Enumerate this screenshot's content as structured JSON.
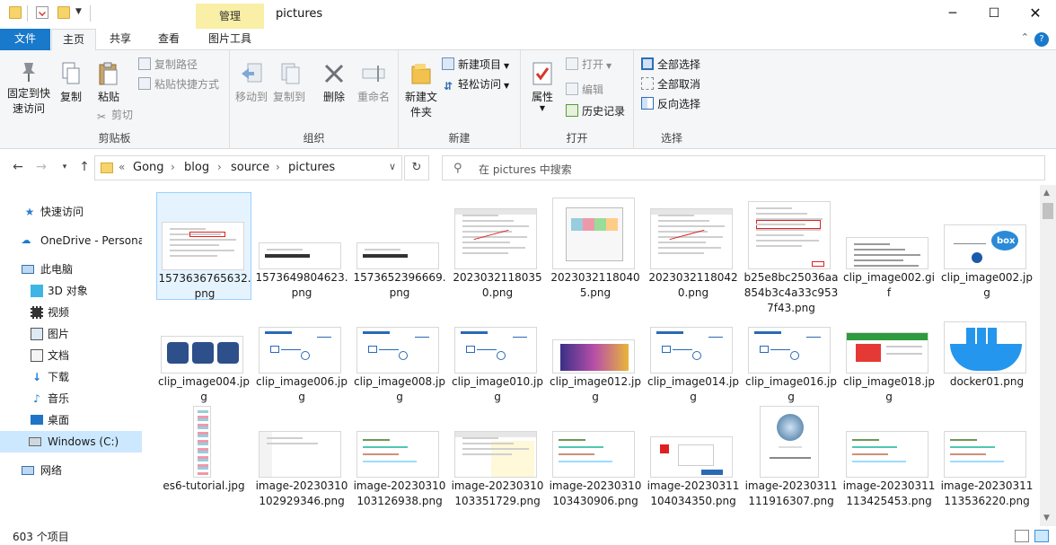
{
  "window": {
    "title": "pictures",
    "contextual_tab_group": "管理",
    "minimize_icon": "minimize-icon",
    "maximize_icon": "maximize-icon",
    "close_icon": "close-icon"
  },
  "ribbon_tabs": [
    "文件",
    "主页",
    "共享",
    "查看",
    "图片工具"
  ],
  "active_tab": "主页",
  "ribbon": {
    "clipboard": {
      "label": "剪贴板",
      "pin": "固定到快速访问",
      "copy": "复制",
      "paste": "粘贴",
      "copy_path": "复制路径",
      "paste_shortcut": "粘贴快捷方式",
      "cut": "剪切"
    },
    "organize": {
      "label": "组织",
      "move_to": "移动到",
      "copy_to": "复制到",
      "delete": "删除",
      "rename": "重命名"
    },
    "new": {
      "label": "新建",
      "new_folder": "新建文件夹",
      "new_item": "新建项目",
      "easy_access": "轻松访问"
    },
    "open": {
      "label": "打开",
      "properties": "属性",
      "open": "打开",
      "edit": "编辑",
      "history": "历史记录"
    },
    "select": {
      "label": "选择",
      "select_all": "全部选择",
      "select_none": "全部取消",
      "invert": "反向选择"
    }
  },
  "address": {
    "overflow": "«",
    "crumbs": [
      "Gong",
      "blog",
      "source",
      "pictures"
    ]
  },
  "search": {
    "placeholder": "在 pictures 中搜索"
  },
  "nav": {
    "quick_access": "快速访问",
    "onedrive": "OneDrive - Persona",
    "this_pc": "此电脑",
    "objects3d": "3D 对象",
    "videos": "视频",
    "pictures": "图片",
    "documents": "文档",
    "downloads": "下载",
    "music": "音乐",
    "desktop": "桌面",
    "windows_c": "Windows (C:)",
    "network": "网络"
  },
  "files": [
    {
      "name": "1573636765632.png",
      "kind": "form"
    },
    {
      "name": "1573649804623.png",
      "kind": "text-tomcat"
    },
    {
      "name": "1573652396669.png",
      "kind": "text-nginx"
    },
    {
      "name": "20230321180350.png",
      "kind": "window"
    },
    {
      "name": "20230321180405.png",
      "kind": "dialog"
    },
    {
      "name": "20230321180420.png",
      "kind": "window"
    },
    {
      "name": "b25e8bc25036aa854b3c4a33c9537f43.png",
      "kind": "redbox"
    },
    {
      "name": "clip_image002.gif",
      "kind": "doc"
    },
    {
      "name": "clip_image002.jpg",
      "kind": "box"
    },
    {
      "name": "clip_image004.jpg",
      "kind": "screens"
    },
    {
      "name": "clip_image006.jpg",
      "kind": "diagram"
    },
    {
      "name": "clip_image008.jpg",
      "kind": "diagram"
    },
    {
      "name": "clip_image010.jpg",
      "kind": "diagram"
    },
    {
      "name": "clip_image012.jpg",
      "kind": "cartoon"
    },
    {
      "name": "clip_image014.jpg",
      "kind": "diagram"
    },
    {
      "name": "clip_image016.jpg",
      "kind": "diagram"
    },
    {
      "name": "clip_image018.jpg",
      "kind": "web"
    },
    {
      "name": "docker01.png",
      "kind": "docker"
    },
    {
      "name": "es6-tutorial.jpg",
      "kind": "tall"
    },
    {
      "name": "image-20230310102929346.png",
      "kind": "white"
    },
    {
      "name": "image-20230310103126938.png",
      "kind": "code"
    },
    {
      "name": "image-20230310103351729.png",
      "kind": "ide-light"
    },
    {
      "name": "image-20230310103430906.png",
      "kind": "code"
    },
    {
      "name": "image-20230311104034350.png",
      "kind": "app"
    },
    {
      "name": "image-20230311111916307.png",
      "kind": "phone"
    },
    {
      "name": "image-20230311113425453.png",
      "kind": "code"
    },
    {
      "name": "image-20230311113536220.png",
      "kind": "code"
    }
  ],
  "status": {
    "count": "603 个项目"
  }
}
